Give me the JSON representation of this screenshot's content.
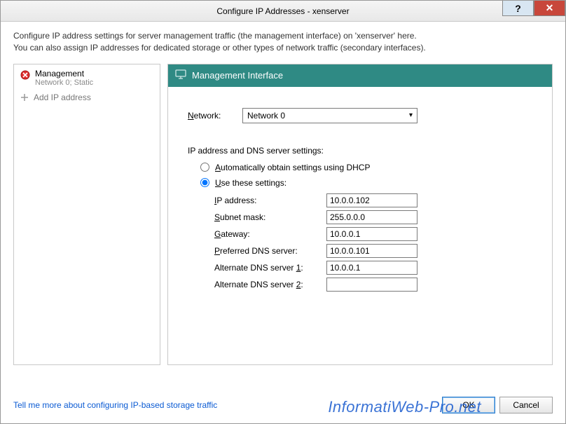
{
  "window": {
    "title": "Configure IP Addresses - xenserver",
    "help_symbol": "?",
    "close_symbol": "✕"
  },
  "description": {
    "line1": "Configure IP address settings for server management traffic (the management interface) on 'xenserver' here.",
    "line2": "You can also assign IP addresses for dedicated storage or other types of network traffic (secondary interfaces)."
  },
  "sidebar": {
    "management": {
      "label": "Management",
      "sub": "Network 0; Static"
    },
    "add": {
      "label": "Add IP address"
    }
  },
  "pane": {
    "header": "Management Interface",
    "network_label": "Network:",
    "network_label_ul": "N",
    "network_value": "Network 0",
    "section_label": "IP address and DNS server settings:",
    "radio_dhcp": "Automatically obtain settings using DHCP",
    "radio_dhcp_ul": "A",
    "radio_static": "Use these settings:",
    "radio_static_ul": "U",
    "fields": {
      "ip_label": "IP address:",
      "ip_ul": "I",
      "ip_value": "10.0.0.102",
      "subnet_label": "Subnet mask:",
      "subnet_ul": "S",
      "subnet_value": "255.0.0.0",
      "gateway_label": "Gateway:",
      "gateway_ul": "G",
      "gateway_value": "10.0.0.1",
      "pdns_label": "Preferred DNS server:",
      "pdns_ul": "P",
      "pdns_value": "10.0.0.101",
      "adns1_label": "Alternate DNS server 1:",
      "adns1_ul": "1",
      "adns1_value": "10.0.0.1",
      "adns2_label": "Alternate DNS server 2:",
      "adns2_ul": "2",
      "adns2_value": ""
    }
  },
  "footer": {
    "link": "Tell me more about configuring IP-based storage traffic",
    "ok": "OK",
    "cancel": "Cancel"
  },
  "watermark": "InformatiWeb-Pro.net"
}
